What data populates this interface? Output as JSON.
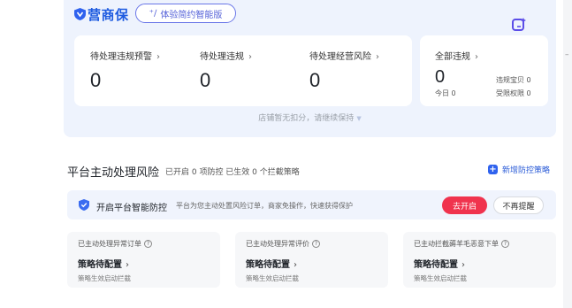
{
  "brand": {
    "name": "营商保",
    "color": "#1f5ce0"
  },
  "version_button": {
    "label": "体验简约智能版"
  },
  "ai_button": {
    "icon": "ai-sparkle-icon"
  },
  "stats": [
    {
      "label": "待处理违规预警",
      "value": "0"
    },
    {
      "label": "待处理违规",
      "value": "0"
    },
    {
      "label": "待处理经营风险",
      "value": "0"
    }
  ],
  "all_violations": {
    "label": "全部违规",
    "value": "0",
    "today": "今日 0",
    "violation_treasure": "违规宝贝 0",
    "restricted_permissions": "受限权限 0"
  },
  "status_line": "店铺暂无扣分，请继续保持",
  "section": {
    "title": "平台主动处理风险",
    "subtitle": "已开启 0 项防控 已生效 0 个拦截策略",
    "new_button": "新增防控策略"
  },
  "banner": {
    "title": "开启平台智能防控",
    "desc": "平台为您主动处置风险订单，商家免操作，快速获得保护",
    "enable_button": "去开启",
    "dismiss_button": "不再提醒",
    "accent": "#f0334e"
  },
  "strategy_cards": [
    {
      "label": "已主动处理异常订单",
      "link": "策略待配置",
      "desc": "策略生效启动拦截"
    },
    {
      "label": "已主动处理异常评价",
      "link": "策略待配置",
      "desc": "策略生效启动拦截"
    },
    {
      "label": "已主动拦截薅羊毛恶意下单",
      "link": "策略待配置",
      "desc": "策略生效启动拦截"
    }
  ]
}
